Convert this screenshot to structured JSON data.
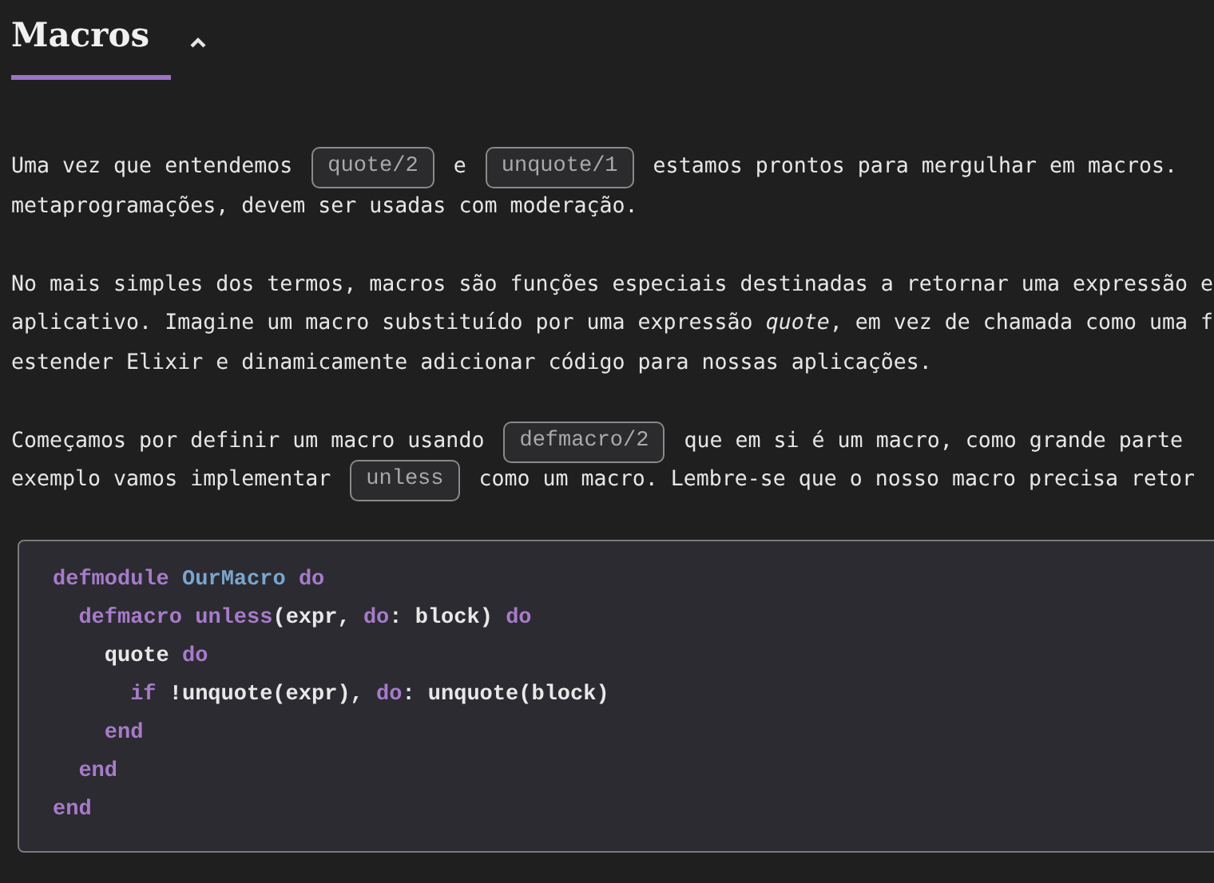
{
  "section": {
    "title": "Macros",
    "expanded": true
  },
  "paragraphs": [
    {
      "lines": [
        [
          {
            "kind": "text",
            "text": "Uma vez que entendemos "
          },
          {
            "kind": "code",
            "text": "quote/2"
          },
          {
            "kind": "text",
            "text": " e "
          },
          {
            "kind": "code",
            "text": "unquote/1"
          },
          {
            "kind": "text",
            "text": " estamos prontos para mergulhar em macros."
          }
        ],
        [
          {
            "kind": "text",
            "text": "metaprogramações, devem ser usadas com moderação."
          }
        ]
      ]
    },
    {
      "lines": [
        [
          {
            "kind": "text",
            "text": "No mais simples dos termos, macros são funções especiais destinadas a retornar uma expressão e"
          }
        ],
        [
          {
            "kind": "text",
            "text": "aplicativo. Imagine um macro substituído por uma expressão *quote*, em vez de chamada como uma f"
          }
        ],
        [
          {
            "kind": "text",
            "text": "estender Elixir e dinamicamente adicionar código para nossas aplicações."
          }
        ]
      ]
    },
    {
      "lines": [
        [
          {
            "kind": "text",
            "text": "Começamos por definir um macro usando "
          },
          {
            "kind": "code",
            "text": "defmacro/2"
          },
          {
            "kind": "text",
            "text": " que em si é um macro, como grande parte"
          }
        ],
        [
          {
            "kind": "text",
            "text": "exemplo vamos implementar "
          },
          {
            "kind": "code",
            "text": "unless"
          },
          {
            "kind": "text",
            "text": " como um macro. Lembre-se que o nosso macro precisa retor"
          }
        ]
      ]
    }
  ],
  "code_block": [
    {
      "tokens": [
        {
          "kind": "keyword",
          "text": "defmodule "
        },
        {
          "kind": "module",
          "text": "OurMacro "
        },
        {
          "kind": "keyword",
          "text": "do"
        }
      ],
      "children": [
        {
          "tokens": [
            {
              "kind": "keyword",
              "text": "defmacro unless"
            },
            {
              "kind": "plain",
              "text": "(expr, "
            },
            {
              "kind": "keyword",
              "text": "do"
            },
            {
              "kind": "plain",
              "text": ": block) "
            },
            {
              "kind": "keyword",
              "text": "do"
            }
          ],
          "children": [
            {
              "tokens": [
                {
                  "kind": "plain",
                  "text": "quote "
                },
                {
                  "kind": "keyword",
                  "text": "do"
                }
              ],
              "children": [
                {
                  "tokens": [
                    {
                      "kind": "keyword",
                      "text": "if "
                    },
                    {
                      "kind": "plain",
                      "text": "!unquote(expr), "
                    },
                    {
                      "kind": "keyword",
                      "text": "do"
                    },
                    {
                      "kind": "plain",
                      "text": ": unquote(block)"
                    }
                  ]
                }
              ]
            },
            {
              "tokens": [
                {
                  "kind": "keyword",
                  "text": "end"
                }
              ]
            }
          ]
        },
        {
          "tokens": [
            {
              "kind": "keyword",
              "text": "end"
            }
          ]
        }
      ]
    },
    {
      "tokens": [
        {
          "kind": "keyword",
          "text": "end"
        }
      ]
    }
  ]
}
